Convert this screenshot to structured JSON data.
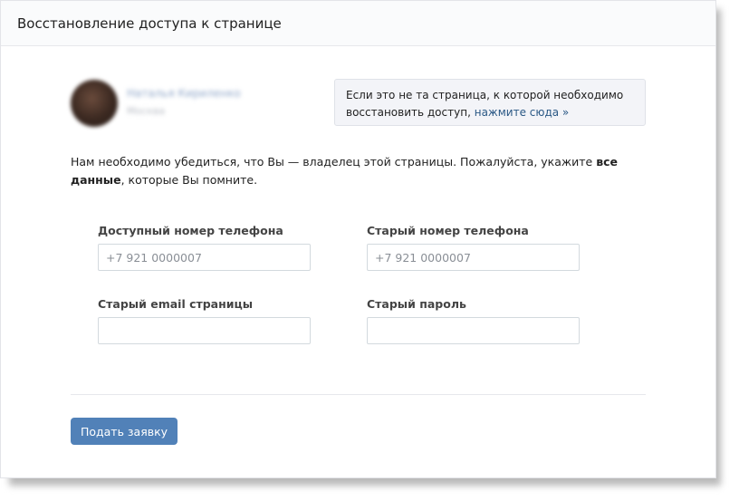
{
  "header": {
    "title": "Восстановление доступа к странице"
  },
  "profile": {
    "name": "Наталья Кириленко",
    "subtitle": "Москва"
  },
  "notice": {
    "text": "Если это не та страница, к которой необходимо восстановить доступ,",
    "link": "нажмите сюда »"
  },
  "intro": {
    "text_before": "Нам необходимо убедиться, что Вы — владелец этой страницы. Пожалуйста, укажите ",
    "bold": "все данные",
    "text_after": ", которые Вы помните."
  },
  "form": {
    "phone": {
      "label": "Доступный номер телефона",
      "placeholder": "+7 921 0000007",
      "value": ""
    },
    "old_phone": {
      "label": "Старый номер телефона",
      "placeholder": "+7 921 0000007",
      "value": ""
    },
    "old_email": {
      "label": "Старый email страницы",
      "placeholder": "",
      "value": ""
    },
    "old_password": {
      "label": "Старый пароль",
      "placeholder": "",
      "value": ""
    },
    "submit_label": "Подать заявку"
  },
  "colors": {
    "accent": "#5181b8",
    "link": "#2a5885",
    "header_bg": "#fafbfc",
    "notice_bg": "#f3f4f8"
  }
}
